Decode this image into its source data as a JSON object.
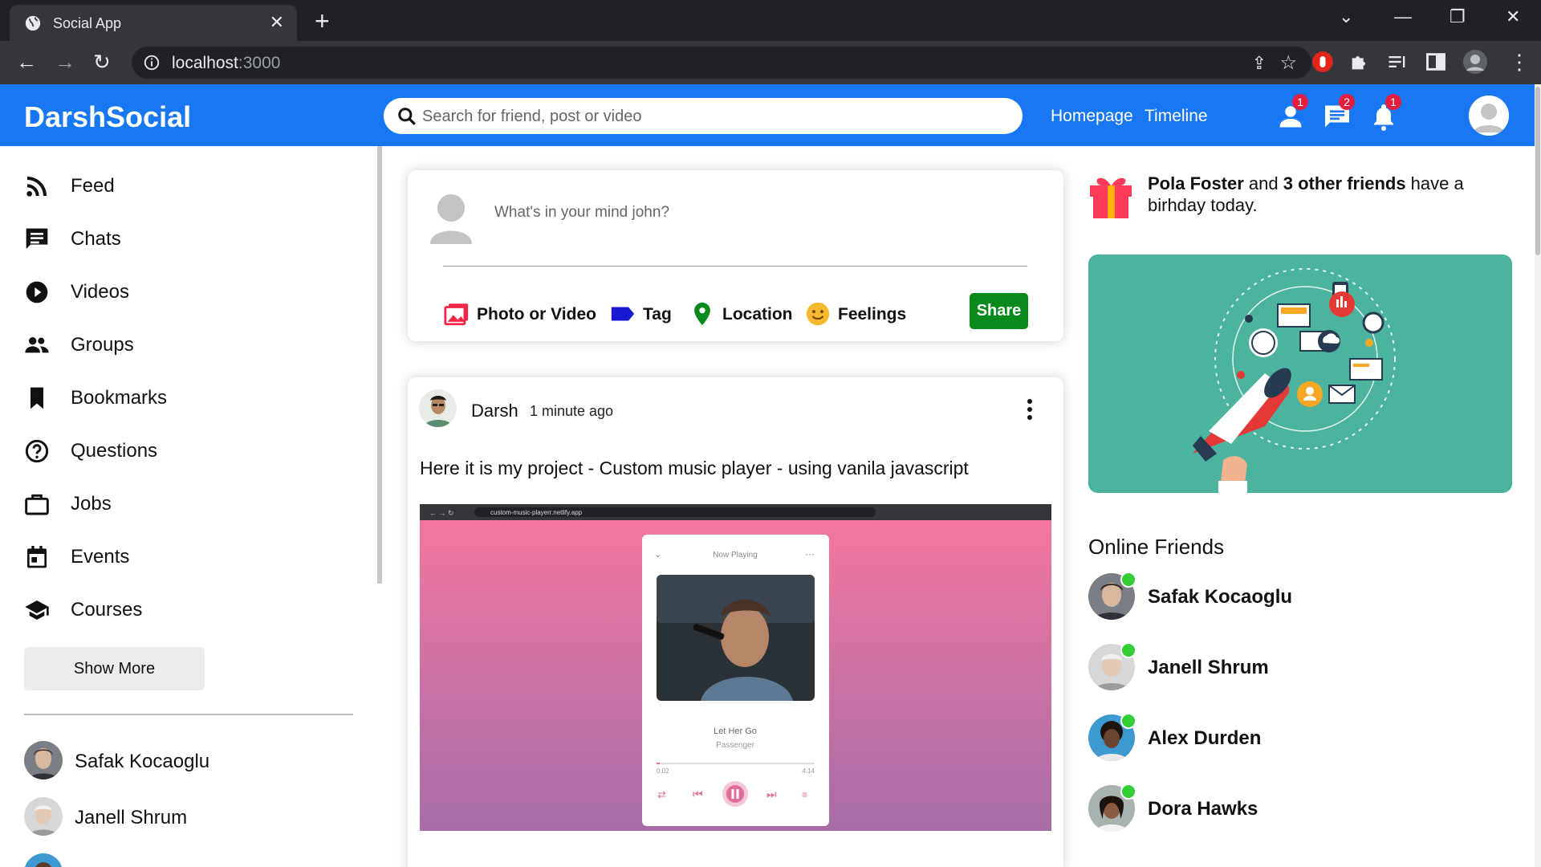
{
  "browser": {
    "tab_title": "Social App",
    "url_host": "localhost",
    "url_port": ":3000"
  },
  "header": {
    "logo": "DarshSocial",
    "search_placeholder": "Search for friend, post or video",
    "links": [
      "Homepage",
      "Timeline"
    ],
    "badges": {
      "friends": "1",
      "messages": "2",
      "notifications": "1"
    },
    "accent_color": "#1877f2"
  },
  "sidebar": {
    "items": [
      {
        "label": "Feed",
        "icon": "rss-icon"
      },
      {
        "label": "Chats",
        "icon": "chat-icon"
      },
      {
        "label": "Videos",
        "icon": "play-circle-icon"
      },
      {
        "label": "Groups",
        "icon": "group-icon"
      },
      {
        "label": "Bookmarks",
        "icon": "bookmark-icon"
      },
      {
        "label": "Questions",
        "icon": "help-circle-icon"
      },
      {
        "label": "Jobs",
        "icon": "briefcase-icon"
      },
      {
        "label": "Events",
        "icon": "calendar-icon"
      },
      {
        "label": "Courses",
        "icon": "school-icon"
      }
    ],
    "show_more": "Show More",
    "friends": [
      "Safak Kocaoglu",
      "Janell Shrum"
    ]
  },
  "composer": {
    "placeholder": "What's in your mind john?",
    "options": [
      "Photo or Video",
      "Tag",
      "Location",
      "Feelings"
    ],
    "share": "Share",
    "share_color": "#0a8a1c"
  },
  "post": {
    "author": "Darsh",
    "time": "1 minute ago",
    "text": "Here it is my project - Custom music player - using vanila javascript",
    "image": {
      "url_text": "custom-music-playerr.netlify.app",
      "now_playing": "Now Playing",
      "song": "Let Her Go",
      "artist": "Passenger",
      "time_current": "0:02",
      "time_total": "4:14"
    }
  },
  "rightbar": {
    "birthday_name": "Pola Foster",
    "birthday_and": " and ",
    "birthday_others": "3 other friends",
    "birthday_rest": " have a birhday today.",
    "online_title": "Online Friends",
    "online_friends": [
      "Safak Kocaoglu",
      "Janell Shrum",
      "Alex Durden",
      "Dora Hawks"
    ]
  }
}
